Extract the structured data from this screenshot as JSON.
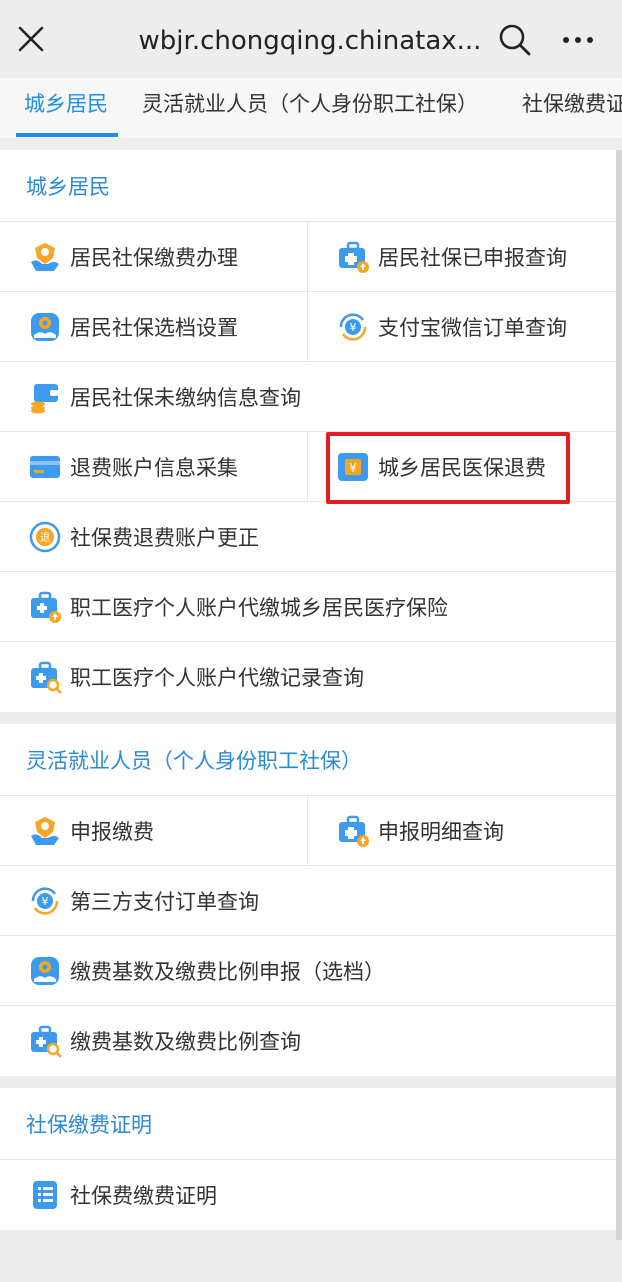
{
  "browser": {
    "url": "wbjr.chongqing.chinatax..."
  },
  "tabs": [
    {
      "label": "城乡居民"
    },
    {
      "label": "灵活就业人员（个人身份职工社保）"
    },
    {
      "label": "社保缴费证"
    }
  ],
  "sections": [
    {
      "title": "城乡居民",
      "items": [
        {
          "label": "居民社保缴费办理",
          "icon": "hand-shield-icon"
        },
        {
          "label": "居民社保已申报查询",
          "icon": "medical-case-icon"
        },
        {
          "label": "居民社保选档设置",
          "icon": "gear-hand-icon"
        },
        {
          "label": "支付宝微信订单查询",
          "icon": "yuan-refresh-icon"
        },
        {
          "label": "居民社保未缴纳信息查询",
          "icon": "wallet-icon"
        },
        {
          "label": "退费账户信息采集",
          "icon": "card-icon"
        },
        {
          "label": "城乡居民医保退费",
          "icon": "yuan-card-icon"
        },
        {
          "label": "社保费退费账户更正",
          "icon": "search-coin-icon"
        },
        {
          "label": "职工医疗个人账户代缴城乡居民医疗保险",
          "icon": "medical-case-upload-icon"
        },
        {
          "label": "职工医疗个人账户代缴记录查询",
          "icon": "medical-case-search-icon"
        }
      ]
    },
    {
      "title": "灵活就业人员（个人身份职工社保）",
      "items": [
        {
          "label": "申报缴费",
          "icon": "hand-shield-icon"
        },
        {
          "label": "申报明细查询",
          "icon": "medical-case-icon"
        },
        {
          "label": "第三方支付订单查询",
          "icon": "yuan-refresh-icon"
        },
        {
          "label": "缴费基数及缴费比例申报（选档）",
          "icon": "gear-hand-icon"
        },
        {
          "label": "缴费基数及缴费比例查询",
          "icon": "medical-case-search-icon"
        }
      ]
    },
    {
      "title": "社保缴费证明",
      "items": [
        {
          "label": "社保费缴费证明",
          "icon": "document-list-icon"
        }
      ]
    }
  ],
  "colors": {
    "accent": "#1e8ee8",
    "highlight_box": "#e31b23",
    "icon_orange": "#f5a623",
    "icon_blue": "#3d9bef"
  }
}
